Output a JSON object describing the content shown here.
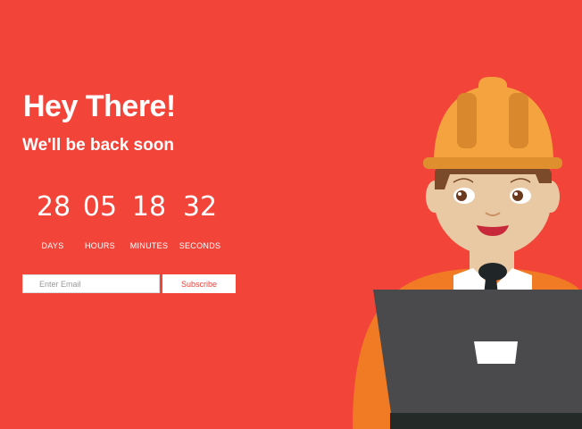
{
  "hero": {
    "title": "Hey There!",
    "subtitle": "We'll be back soon"
  },
  "countdown": [
    {
      "value": "28",
      "label": "DAYS"
    },
    {
      "value": "05",
      "label": "HOURS"
    },
    {
      "value": "18",
      "label": "MINUTES"
    },
    {
      "value": "32",
      "label": "SECONDS"
    }
  ],
  "form": {
    "email_placeholder": "Enter Email",
    "email_value": "",
    "subscribe_label": "Subscribe"
  },
  "illustration": {
    "icon": "construction-worker-with-laptop-icon"
  },
  "colors": {
    "background": "#f3443a",
    "helmet": "#f5a33e",
    "shirt": "#f07b24",
    "laptop": "#4a4a4c"
  }
}
